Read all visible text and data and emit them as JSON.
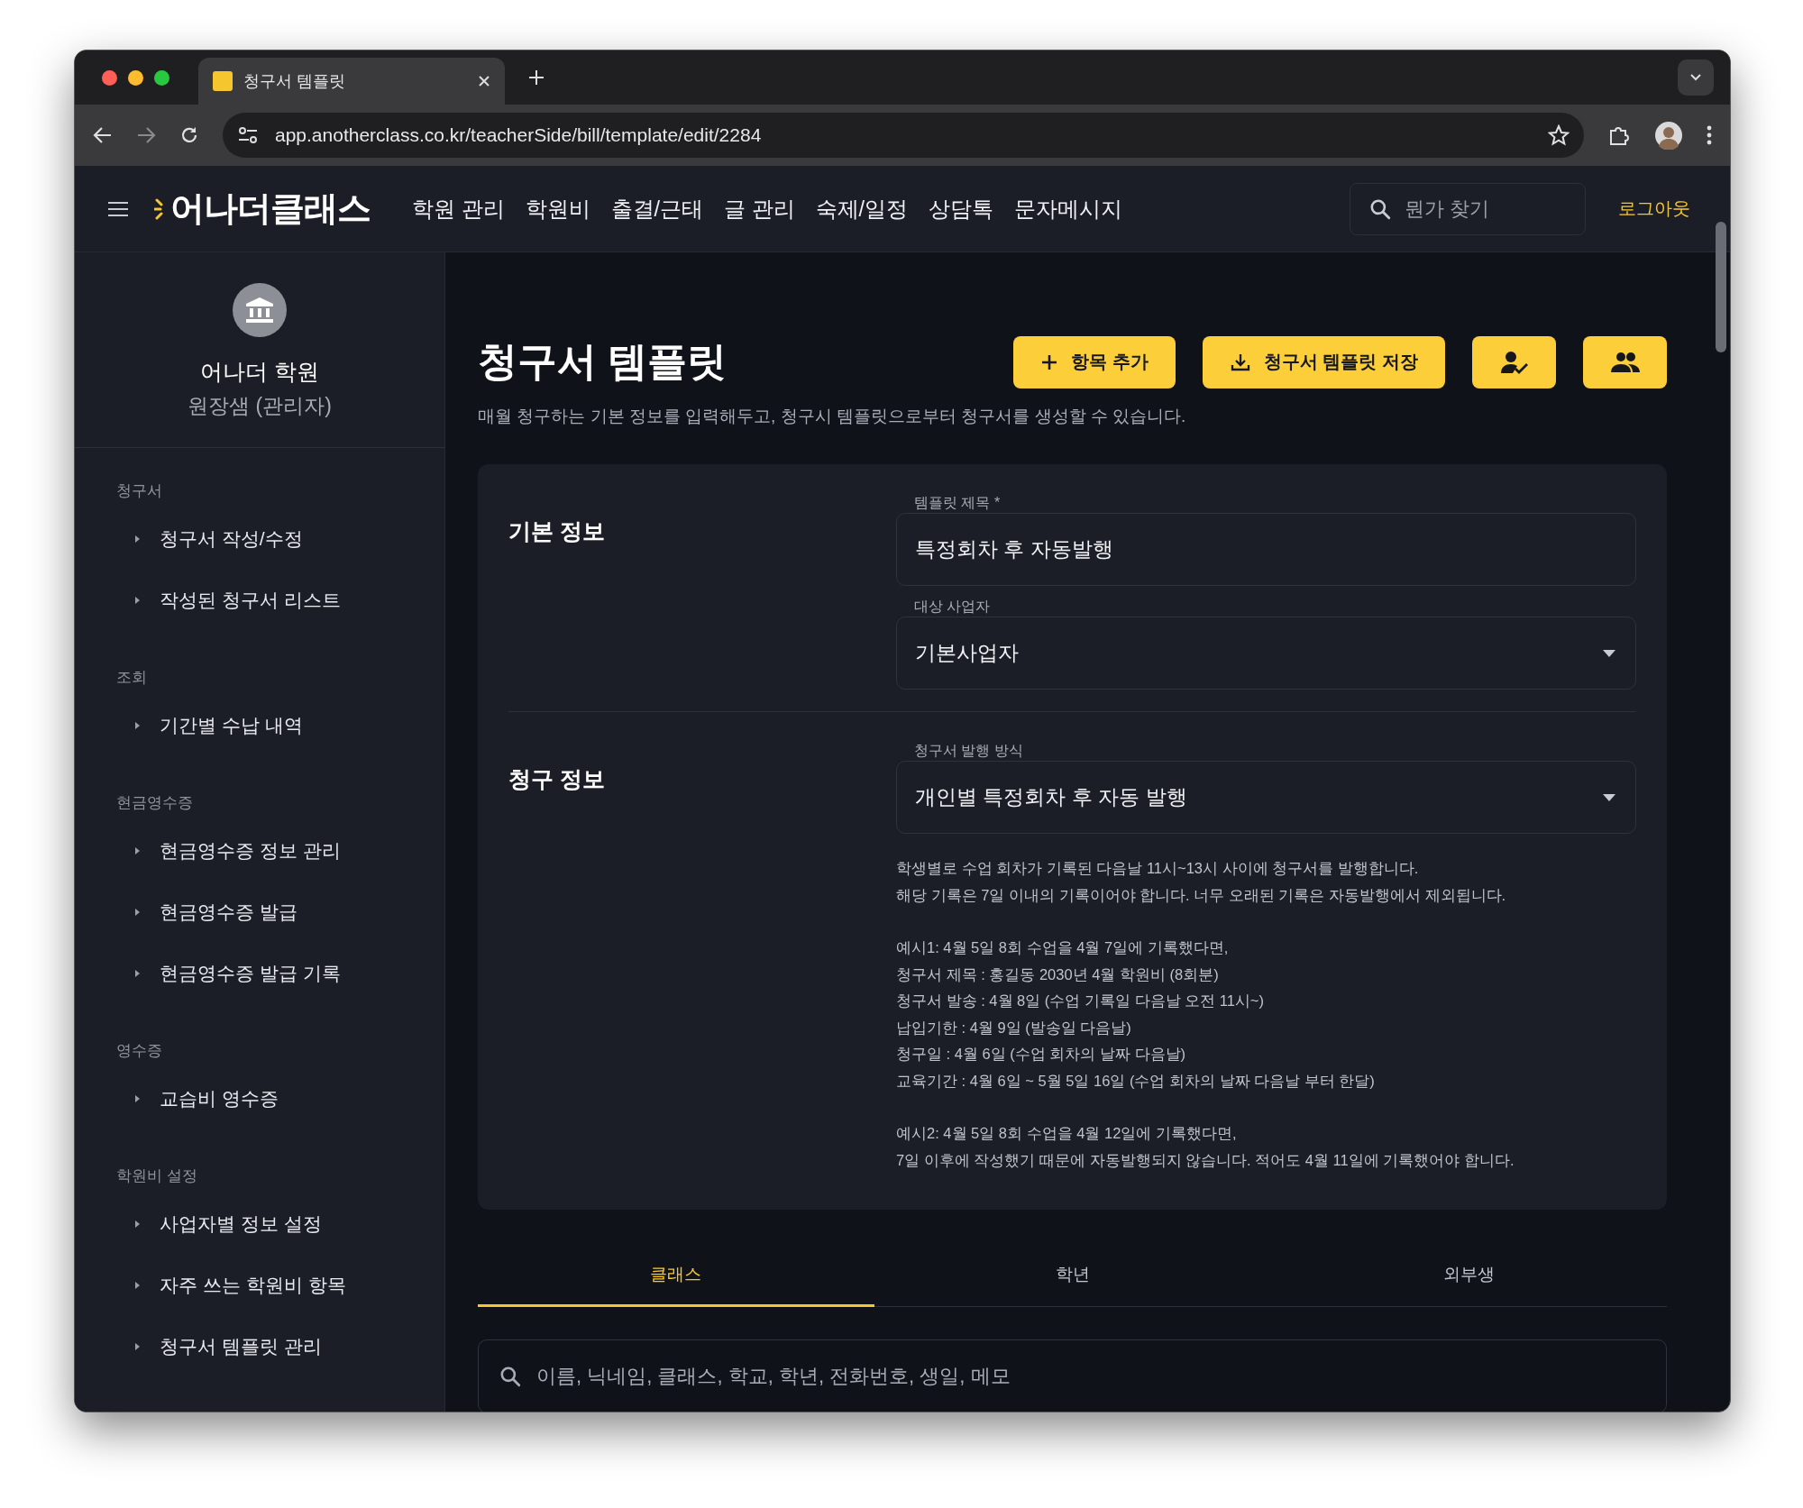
{
  "browser": {
    "tab_title": "청구서 템플릿",
    "address": "app.anotherclass.co.kr/teacherSide/bill/template/edit/2284"
  },
  "header": {
    "logo": "어나더클래스",
    "nav": [
      "학원 관리",
      "학원비",
      "출결/근태",
      "글 관리",
      "숙제/일정",
      "상담톡",
      "문자메시지"
    ],
    "search": {
      "placeholder": "뭔가 찾기"
    },
    "logout": "로그아웃"
  },
  "sidebar": {
    "academy": "어나더 학원",
    "role": "원장샘 (관리자)",
    "sections": [
      {
        "title": "청구서",
        "items": [
          "청구서 작성/수정",
          "작성된 청구서 리스트"
        ]
      },
      {
        "title": "조회",
        "items": [
          "기간별 수납 내역"
        ]
      },
      {
        "title": "현금영수증",
        "items": [
          "현금영수증 정보 관리",
          "현금영수증 발급",
          "현금영수증 발급 기록"
        ]
      },
      {
        "title": "영수증",
        "items": [
          "교습비 영수증"
        ]
      },
      {
        "title": "학원비 설정",
        "items": [
          "사업자별 정보 설정",
          "자주 쓰는 학원비 항목",
          "청구서 템플릿 관리"
        ]
      }
    ]
  },
  "page": {
    "title": "청구서 템플릿",
    "description": "매월 청구하는 기본 정보를 입력해두고, 청구시 템플릿으로부터 청구서를 생성할 수 있습니다.",
    "buttons": [
      {
        "kind": "add",
        "label": "항목 추가"
      },
      {
        "kind": "save",
        "label": "청구서 템플릿 저장"
      },
      {
        "kind": "person-check"
      },
      {
        "kind": "group"
      }
    ]
  },
  "form": {
    "sections": [
      {
        "title": "기본 정보",
        "fields": [
          {
            "kind": "text",
            "label": "템플릿 제목 *",
            "value": "특정회차 후 자동발행"
          },
          {
            "kind": "select",
            "label": "대상 사업자",
            "value": "기본사업자"
          }
        ]
      },
      {
        "title": "청구 정보",
        "fields": [
          {
            "kind": "select",
            "label": "청구서 발행 방식",
            "value": "개인별 특정회차 후 자동 발행"
          }
        ],
        "notes": [
          [
            "학생별로 수업 회차가 기록된 다음날 11시~13시 사이에 청구서를 발행합니다.",
            "해당 기록은 7일 이내의 기록이어야 합니다. 너무 오래된 기록은 자동발행에서 제외됩니다."
          ],
          [
            "예시1: 4월 5일 8회 수업을 4월 7일에 기록했다면,",
            "청구서 제목 : 홍길동 2030년 4월 학원비 (8회분)",
            "청구서 발송 : 4월 8일 (수업 기록일 다음날 오전 11시~)",
            "납입기한 : 4월 9일 (발송일 다음날)",
            "청구일 : 4월 6일 (수업 회차의 날짜 다음날)",
            "교육기간 : 4월 6일 ~ 5월 5일 16일 (수업 회차의 날짜 다음날 부터 한달)"
          ],
          [
            "예시2: 4월 5일 8회 수업을 4월 12일에 기록했다면,",
            "7일 이후에 작성했기 때문에 자동발행되지 않습니다. 적어도 4월 11일에 기록했어야 합니다."
          ]
        ]
      }
    ]
  },
  "tabs": [
    {
      "label": "클래스",
      "selected": true
    },
    {
      "label": "학년",
      "selected": false
    },
    {
      "label": "외부생",
      "selected": false
    }
  ],
  "student_search": {
    "placeholder": "이름, 닉네임, 클래스, 학교, 학년, 전화번호, 생일, 메모"
  }
}
